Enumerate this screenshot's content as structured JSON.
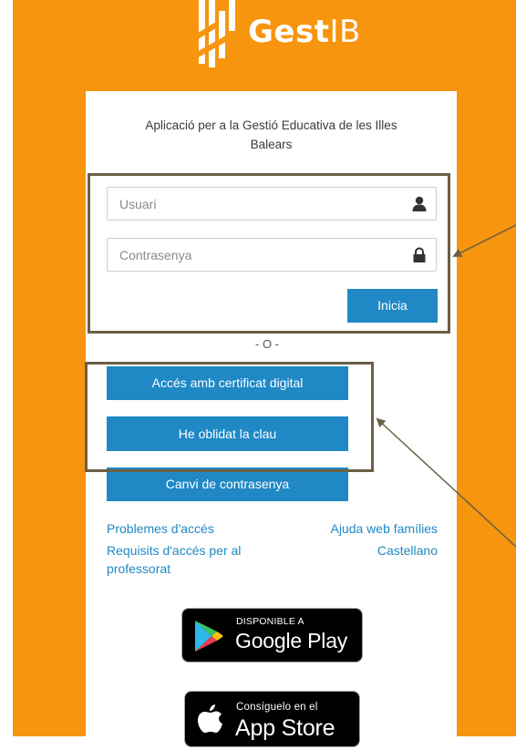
{
  "brand": {
    "name_bold": "Gest",
    "name_thin": "IB"
  },
  "subtitle": "Aplicació per a la Gestió Educativa de les Illes Balears",
  "login": {
    "username_placeholder": "Usuari",
    "password_placeholder": "Contrasenya",
    "submit_label": "Inicia"
  },
  "divider": "- O -",
  "actions": {
    "certificate": "Accés amb certificat digital",
    "forgot": "He oblidat la clau",
    "change_password": "Canvi de contrasenya"
  },
  "links": {
    "access_problems": "Problemes d'accés",
    "requirements_line1": "Requisits d'accés per al",
    "requirements_line2": "professorat",
    "family_help": "Ajuda web famílies",
    "castellano": "Castellano"
  },
  "stores": {
    "google_small": "DISPONIBLE A",
    "google_big": "Google Play",
    "apple_small": "Consíguelo en el",
    "apple_big": "App Store"
  },
  "colors": {
    "background": "#f7950e",
    "accent": "#1f88c5",
    "annotation": "#6b5f45"
  },
  "icons": [
    "logo-mark-icon",
    "user-icon",
    "lock-icon",
    "google-play-icon",
    "apple-icon"
  ]
}
